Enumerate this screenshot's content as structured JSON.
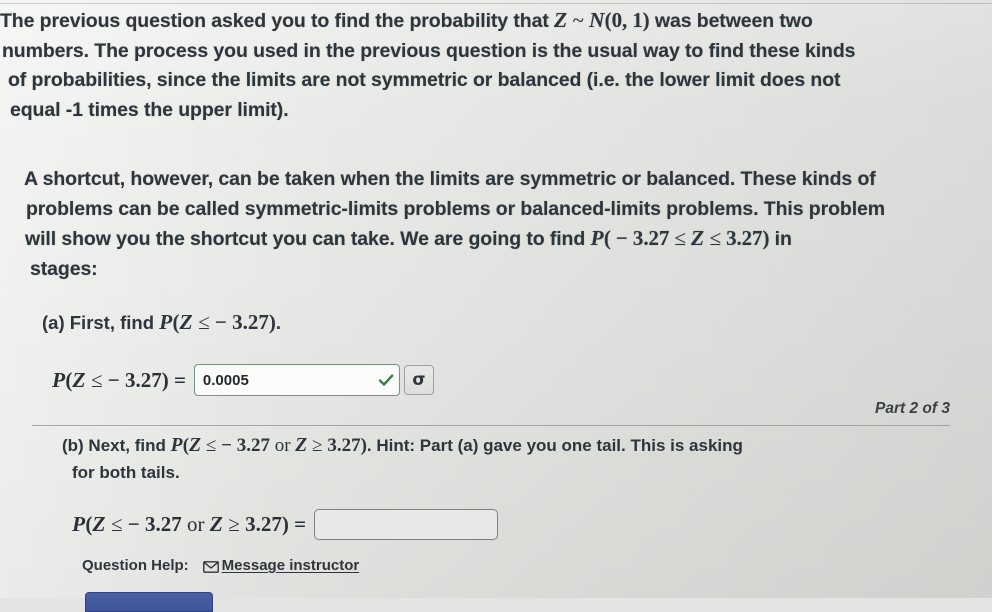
{
  "intro": {
    "paragraph1": [
      "The previous question asked you to find the probability that Z ~ N(0, 1) was between two",
      "numbers. The process you used in the previous question is the usual way to find these kinds",
      "of probabilities, since the limits are not symmetric or balanced (i.e. the lower limit does not",
      "equal -1 times the upper limit)."
    ],
    "paragraph1_parts": {
      "l1a": "The previous question asked you to find the probability that ",
      "l1_var": "Z",
      "l1_tilde": " ~ ",
      "l1_dist": "N",
      "l1_params": "(0, 1)",
      "l1b": " was between two",
      "l2": "numbers. The process you used in the previous question is the usual way to find these kinds",
      "l3": "of probabilities, since the limits are not symmetric or balanced (i.e. the lower limit does not",
      "l4": "equal -1 times the upper limit)."
    },
    "paragraph2_parts": {
      "l1": "A shortcut, however, can be taken when the limits are symmetric or balanced. These kinds of",
      "l2": "problems can be called symmetric-limits problems or balanced-limits problems. This problem",
      "l3a": "will show you the shortcut you can take. We are going to find ",
      "l3_p": "P",
      "l3_open": "( ",
      "l3_minus": "− ",
      "l3_low": "3.27",
      "l3_le1": " ≤ ",
      "l3_z": "Z",
      "l3_le2": " ≤ ",
      "l3_high": "3.27",
      "l3_close": ")",
      "l3b": " in",
      "l4": "stages:"
    }
  },
  "part_a": {
    "label_prefix": "(a) First, find ",
    "label_p": "P",
    "label_open": "(",
    "label_z": "Z",
    "label_le": " ≤ ",
    "label_minus": " − ",
    "label_value": "3.27",
    "label_close": ")",
    "label_period": ".",
    "equation": {
      "p": "P",
      "open": "(",
      "z": "Z",
      "le": " ≤ ",
      "minus": " − ",
      "value": "3.27",
      "close": ")",
      "equals": " ="
    },
    "answer_value": "0.0005",
    "answer_placeholder": "",
    "validation_icon": "check-icon",
    "validation_color": "#3f7a4e",
    "sigma_button_label": "σ",
    "field_border_color": "#7c9384"
  },
  "part_counter": "Part 2 of 3",
  "part_b": {
    "label_prefix": "(b) Next, find ",
    "label_p": "P",
    "label_open": "(",
    "label_z1": "Z",
    "label_le": " ≤ ",
    "label_minus": " − ",
    "label_low": "3.27",
    "label_or": "  or  ",
    "label_z2": "Z",
    "label_ge": " ≥ ",
    "label_high": "3.27",
    "label_close": ")",
    "hint_text": ". Hint: Part (a) gave you one tail. This is asking",
    "hint_line2": "for both tails.",
    "equation": {
      "p": "P",
      "open": "(",
      "z1": "Z",
      "le": " ≤ ",
      "minus": " − ",
      "low": "3.27",
      "or": "  or  ",
      "z2": "Z",
      "ge": " ≥ ",
      "high": "3.27",
      "close": ")",
      "equals": " ="
    },
    "answer_value": "",
    "answer_placeholder": ""
  },
  "question_help": {
    "label": "Question Help:",
    "link_text": "Message instructor",
    "icon": "envelope-icon"
  },
  "submit_button": {
    "label": ""
  },
  "colors": {
    "background": "#e4e4e2",
    "text": "#2e353b",
    "valid_green": "#3f7a4e",
    "field_border_green": "#7c9384",
    "field_border_gray": "#7b8287",
    "submit_blue": "#3f549b"
  }
}
